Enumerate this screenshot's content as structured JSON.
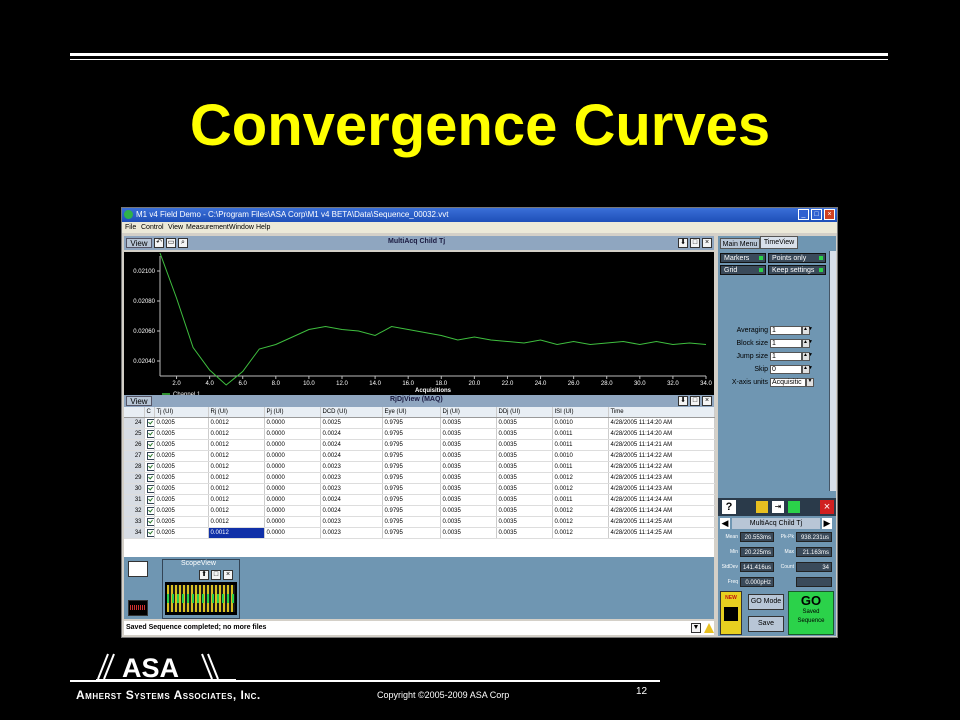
{
  "slide": {
    "title": "Convergence Curves",
    "company": "Amherst Systems Associates, Inc.",
    "logo_text": "ASA",
    "copyright": "Copyright ©2005-2009 ASA Corp",
    "page_number": "12"
  },
  "app": {
    "title": "M1 v4 Field Demo - C:\\Program Files\\ASA Corp\\M1 v4 BETA\\Data\\Sequence_00032.vvt",
    "menu": [
      "File",
      "Control",
      "View",
      "Measurement",
      "Window",
      "Help"
    ]
  },
  "chart_panel": {
    "view_label": "View",
    "title": "MultiAcq Child Tj",
    "legend": "Channel 1"
  },
  "chart_data": {
    "type": "line",
    "title": "MultiAcq Child Tj",
    "xlabel": "Acquisitions",
    "ylabel": "",
    "xlim": [
      1,
      34
    ],
    "ylim": [
      0.0203,
      0.0211
    ],
    "xticks": [
      2.0,
      4.0,
      6.0,
      8.0,
      10.0,
      12.0,
      14.0,
      16.0,
      18.0,
      20.0,
      22.0,
      24.0,
      26.0,
      28.0,
      30.0,
      32.0,
      34.0
    ],
    "xtick_labels": [
      "2.0",
      "4.0",
      "6.0",
      "8.0",
      "10.0",
      "12.0",
      "14.0",
      "16.0",
      "18.0",
      "20.0",
      "22.0",
      "24.0",
      "26.0",
      "28.0",
      "30.0",
      "32.0",
      "34.0"
    ],
    "yticks": [
      0.0204,
      0.0206,
      0.0208,
      0.021
    ],
    "ytick_labels": [
      "0.02040",
      "0.02060",
      "0.02080",
      "0.02100"
    ],
    "grid": false,
    "line_color": "#3fbf3f",
    "series": [
      {
        "name": "Channel 1",
        "x": [
          1,
          2,
          3,
          4,
          5,
          6,
          7,
          8,
          9,
          10,
          11,
          12,
          13,
          14,
          15,
          16,
          17,
          18,
          19,
          20,
          21,
          22,
          23,
          24,
          25,
          26,
          27,
          28,
          29,
          30,
          31,
          32,
          33,
          34
        ],
        "y": [
          0.02112,
          0.02082,
          0.02049,
          0.02034,
          0.02024,
          0.02033,
          0.02048,
          0.02051,
          0.02056,
          0.02061,
          0.02063,
          0.02061,
          0.0206,
          0.02057,
          0.02063,
          0.02061,
          0.02059,
          0.02057,
          0.02054,
          0.02056,
          0.02054,
          0.02053,
          0.02052,
          0.02054,
          0.02051,
          0.02053,
          0.02051,
          0.02052,
          0.02053,
          0.02051,
          0.02053,
          0.02051,
          0.02052,
          0.02051
        ]
      }
    ]
  },
  "grid_panel": {
    "view_label": "View",
    "title": "RjDjView (MAQ)",
    "columns": [
      "",
      "C",
      "Tj (UI)",
      "Rj (UI)",
      "Pj (UI)",
      "DCD (UI)",
      "Eye (UI)",
      "Dj (UI)",
      "DDj (UI)",
      "ISI (UI)",
      "Time"
    ],
    "rows": [
      [
        "24",
        "0.0205",
        "0.0012",
        "0.0000",
        "0.0025",
        "0.9795",
        "0.0035",
        "0.0035",
        "0.0010",
        "4/28/2005 11:14:20 AM"
      ],
      [
        "25",
        "0.0205",
        "0.0012",
        "0.0000",
        "0.0024",
        "0.9795",
        "0.0035",
        "0.0035",
        "0.0011",
        "4/28/2005 11:14:20 AM"
      ],
      [
        "26",
        "0.0205",
        "0.0012",
        "0.0000",
        "0.0024",
        "0.9795",
        "0.0035",
        "0.0035",
        "0.0011",
        "4/28/2005 11:14:21 AM"
      ],
      [
        "27",
        "0.0205",
        "0.0012",
        "0.0000",
        "0.0024",
        "0.9795",
        "0.0035",
        "0.0035",
        "0.0010",
        "4/28/2005 11:14:22 AM"
      ],
      [
        "28",
        "0.0205",
        "0.0012",
        "0.0000",
        "0.0023",
        "0.9795",
        "0.0035",
        "0.0035",
        "0.0011",
        "4/28/2005 11:14:22 AM"
      ],
      [
        "29",
        "0.0205",
        "0.0012",
        "0.0000",
        "0.0023",
        "0.9795",
        "0.0035",
        "0.0035",
        "0.0012",
        "4/28/2005 11:14:23 AM"
      ],
      [
        "30",
        "0.0205",
        "0.0012",
        "0.0000",
        "0.0023",
        "0.9795",
        "0.0035",
        "0.0035",
        "0.0012",
        "4/28/2005 11:14:23 AM"
      ],
      [
        "31",
        "0.0205",
        "0.0012",
        "0.0000",
        "0.0024",
        "0.9795",
        "0.0035",
        "0.0035",
        "0.0011",
        "4/28/2005 11:14:24 AM"
      ],
      [
        "32",
        "0.0205",
        "0.0012",
        "0.0000",
        "0.0024",
        "0.9795",
        "0.0035",
        "0.0035",
        "0.0012",
        "4/28/2005 11:14:24 AM"
      ],
      [
        "33",
        "0.0205",
        "0.0012",
        "0.0000",
        "0.0023",
        "0.9795",
        "0.0035",
        "0.0035",
        "0.0012",
        "4/28/2005 11:14:25 AM"
      ],
      [
        "34",
        "0.0205",
        "0.0012",
        "0.0000",
        "0.0023",
        "0.9795",
        "0.0035",
        "0.0035",
        "0.0012",
        "4/28/2005 11:14:25 AM"
      ]
    ]
  },
  "scope": {
    "title": "ScopeView"
  },
  "status_text": "Saved Sequence completed; no more files",
  "right_panel": {
    "tabs": [
      "Main Menu",
      "TimeView"
    ],
    "options": [
      "Markers",
      "Points only",
      "Grid",
      "Keep settings"
    ],
    "params": [
      {
        "label": "Averaging",
        "value": "1"
      },
      {
        "label": "Block size",
        "value": "1"
      },
      {
        "label": "Jump size",
        "value": "1"
      },
      {
        "label": "Skip",
        "value": "0"
      },
      {
        "label": "X-axis units",
        "value": "Acquisitic"
      }
    ],
    "nav_title": "MultiAcq Child Tj",
    "stats": [
      {
        "label": "Mean",
        "value": "20.553ms"
      },
      {
        "label": "Pk-Pk",
        "value": "938.231us"
      },
      {
        "label": "Min",
        "value": "20.225ms"
      },
      {
        "label": "Max",
        "value": "21.163ms"
      },
      {
        "label": "StdDev",
        "value": "141.416us"
      },
      {
        "label": "Count",
        "value": "34"
      },
      {
        "label": "Freq",
        "value": "0.000pHz"
      }
    ],
    "new_label": "NEW",
    "go_mode_label": "GO Mode",
    "save_label": "Save",
    "go_label": "GO",
    "go_sub1": "Saved",
    "go_sub2": "Sequence"
  }
}
